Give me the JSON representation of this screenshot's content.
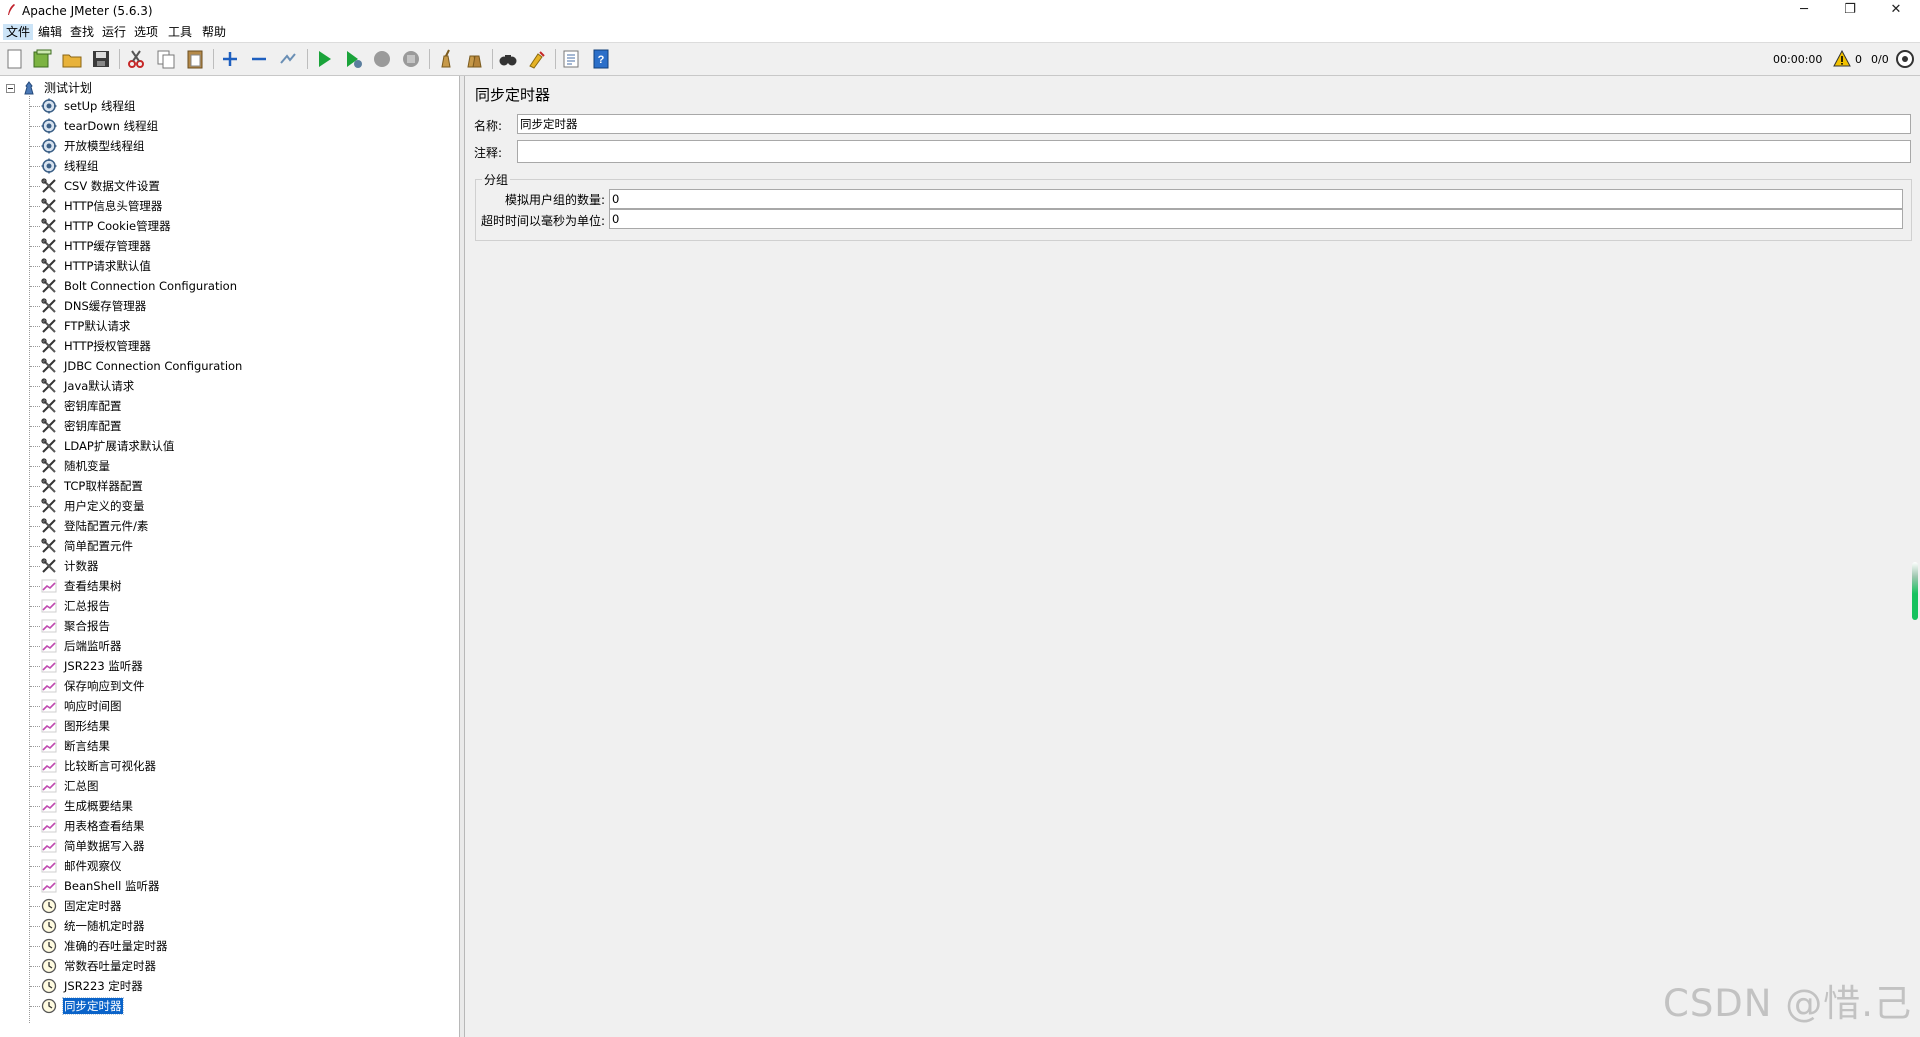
{
  "window": {
    "title": "Apache JMeter (5.6.3)",
    "minimize": "─",
    "restore": "❐",
    "close": "✕"
  },
  "menu": [
    "文件",
    "编辑",
    "查找",
    "运行",
    "选项",
    "工具",
    "帮助"
  ],
  "toolbar": {
    "timer": "00:00:00",
    "warning_count": "0",
    "thread_count": "0/0",
    "icons": [
      "new-icon",
      "templates-icon",
      "open-icon",
      "save-icon",
      "cut-icon",
      "copy-icon",
      "paste-icon",
      "expand-icon",
      "collapse-icon",
      "toggle-icon",
      "start-icon",
      "start-no-pauses-icon",
      "stop-icon",
      "shutdown-icon",
      "clear-icon",
      "clear-all-icon",
      "search-icon",
      "reset-search-icon",
      "function-helper-icon",
      "help-icon"
    ]
  },
  "tree": {
    "root": "测试计划",
    "items": [
      {
        "label": "setUp 线程组",
        "icon": "gear"
      },
      {
        "label": "tearDown 线程组",
        "icon": "gear"
      },
      {
        "label": "开放模型线程组",
        "icon": "gear"
      },
      {
        "label": "线程组",
        "icon": "gear"
      },
      {
        "label": "CSV 数据文件设置",
        "icon": "tools"
      },
      {
        "label": "HTTP信息头管理器",
        "icon": "tools"
      },
      {
        "label": "HTTP Cookie管理器",
        "icon": "tools"
      },
      {
        "label": "HTTP缓存管理器",
        "icon": "tools"
      },
      {
        "label": "HTTP请求默认值",
        "icon": "tools"
      },
      {
        "label": "Bolt Connection Configuration",
        "icon": "tools"
      },
      {
        "label": "DNS缓存管理器",
        "icon": "tools"
      },
      {
        "label": "FTP默认请求",
        "icon": "tools"
      },
      {
        "label": "HTTP授权管理器",
        "icon": "tools"
      },
      {
        "label": "JDBC Connection Configuration",
        "icon": "tools"
      },
      {
        "label": "Java默认请求",
        "icon": "tools"
      },
      {
        "label": "密钥库配置",
        "icon": "tools"
      },
      {
        "label": "密钥库配置",
        "icon": "tools"
      },
      {
        "label": "LDAP扩展请求默认值",
        "icon": "tools"
      },
      {
        "label": "随机变量",
        "icon": "tools"
      },
      {
        "label": "TCP取样器配置",
        "icon": "tools"
      },
      {
        "label": "用户定义的变量",
        "icon": "tools"
      },
      {
        "label": "登陆配置元件/素",
        "icon": "tools"
      },
      {
        "label": "简单配置元件",
        "icon": "tools"
      },
      {
        "label": "计数器",
        "icon": "tools"
      },
      {
        "label": "查看结果树",
        "icon": "graph"
      },
      {
        "label": "汇总报告",
        "icon": "graph"
      },
      {
        "label": "聚合报告",
        "icon": "graph"
      },
      {
        "label": "后端监听器",
        "icon": "graph"
      },
      {
        "label": "JSR223 监听器",
        "icon": "graph"
      },
      {
        "label": "保存响应到文件",
        "icon": "graph"
      },
      {
        "label": "响应时间图",
        "icon": "graph"
      },
      {
        "label": "图形结果",
        "icon": "graph"
      },
      {
        "label": "断言结果",
        "icon": "graph"
      },
      {
        "label": "比较断言可视化器",
        "icon": "graph"
      },
      {
        "label": "汇总图",
        "icon": "graph"
      },
      {
        "label": "生成概要结果",
        "icon": "graph"
      },
      {
        "label": "用表格查看结果",
        "icon": "graph"
      },
      {
        "label": "简单数据写入器",
        "icon": "graph"
      },
      {
        "label": "邮件观察仪",
        "icon": "graph"
      },
      {
        "label": "BeanShell 监听器",
        "icon": "graph"
      },
      {
        "label": "固定定时器",
        "icon": "timer"
      },
      {
        "label": "统一随机定时器",
        "icon": "timer"
      },
      {
        "label": "准确的吞吐量定时器",
        "icon": "timer"
      },
      {
        "label": "常数吞吐量定时器",
        "icon": "timer"
      },
      {
        "label": "JSR223 定时器",
        "icon": "timer"
      },
      {
        "label": "同步定时器",
        "icon": "timer",
        "selected": true
      }
    ]
  },
  "panel": {
    "title": "同步定时器",
    "name_label": "名称:",
    "name_value": "同步定时器",
    "comment_label": "注释:",
    "comment_value": "",
    "group_title": "分组",
    "users_label": "模拟用户组的数量:",
    "users_value": "0",
    "timeout_label": "超时时间以毫秒为单位:",
    "timeout_value": "0"
  },
  "watermark": "CSDN @惜.己"
}
